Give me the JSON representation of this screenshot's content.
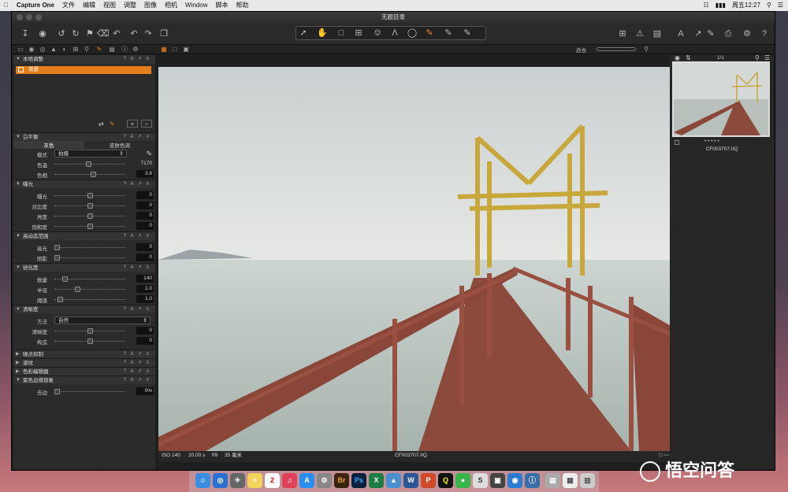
{
  "menubar": {
    "app": "Capture One",
    "items": [
      "文件",
      "编辑",
      "视图",
      "调整",
      "图像",
      "相机",
      "Window",
      "脚本",
      "帮助"
    ],
    "clock": "周五12:27"
  },
  "window": {
    "title": "无题目录"
  },
  "toolbar": {
    "cursor_tools_label": "光标工具"
  },
  "subbar": {
    "zoom_label": "适合"
  },
  "left_panel": {
    "local_adjust": {
      "title": "本地调整",
      "layer": "背景"
    },
    "white_balance": {
      "title": "白平衡",
      "tabs": [
        "灰色",
        "皮肤色调"
      ],
      "mode_label": "模式",
      "mode_value": "拍摄",
      "temp_label": "色温",
      "temp_value": "7170",
      "tint_label": "色相",
      "tint_value": "3.8"
    },
    "exposure": {
      "title": "曝光",
      "rows": [
        {
          "label": "曝光",
          "value": "0"
        },
        {
          "label": "对比度",
          "value": "0"
        },
        {
          "label": "亮度",
          "value": "0"
        },
        {
          "label": "饱和度",
          "value": "0"
        }
      ]
    },
    "hdr": {
      "title": "高动态范围",
      "rows": [
        {
          "label": "高光",
          "value": "0"
        },
        {
          "label": "阴影",
          "value": "0"
        }
      ]
    },
    "sharpening": {
      "title": "锐化度",
      "rows": [
        {
          "label": "数量",
          "value": "140"
        },
        {
          "label": "半径",
          "value": "1.0"
        },
        {
          "label": "阈值",
          "value": "1.0"
        }
      ]
    },
    "clarity": {
      "title": "清晰度",
      "method_label": "方法",
      "method_value": "自然",
      "rows": [
        {
          "label": "清晰度",
          "value": "0"
        },
        {
          "label": "构造",
          "value": "0"
        }
      ]
    },
    "collapsed": [
      "噪点抑制",
      "波纹",
      "色彩编辑器"
    ],
    "fringe": {
      "title": "紫色边缘现象",
      "label": "去边",
      "value": "0%"
    }
  },
  "viewer": {
    "iso": "ISO 140",
    "shutter": "20.00 s",
    "aperture": "f/9",
    "focal": "35 毫米",
    "filename": "CF003707.IIQ"
  },
  "right_panel": {
    "count": "1/1",
    "thumb_name": "CF003707.IIQ",
    "dots": "• • • • •"
  },
  "watermark": "悟空问答"
}
